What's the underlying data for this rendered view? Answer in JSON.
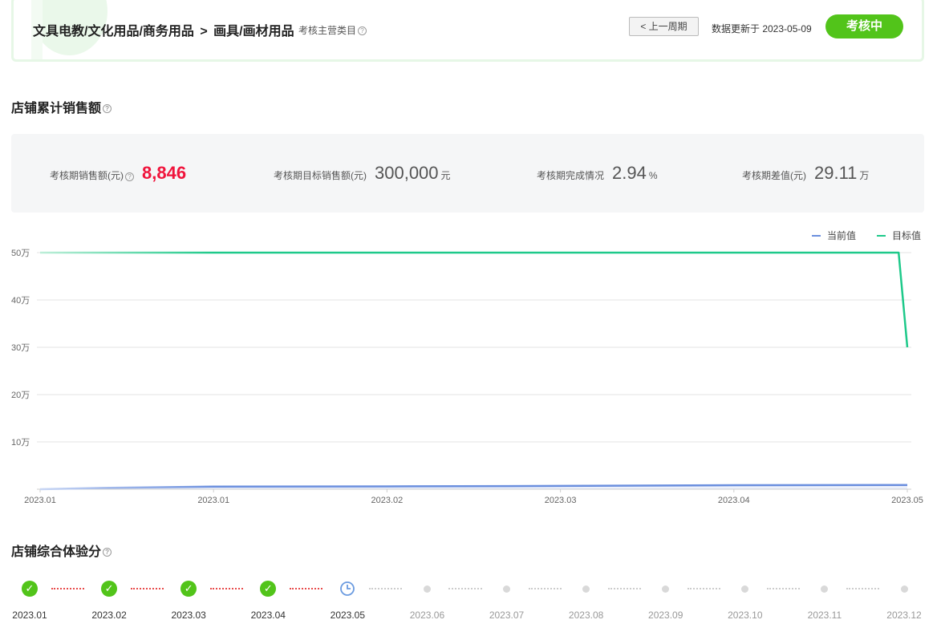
{
  "header": {
    "breadcrumb": [
      "文具电教/文化用品/商务用品",
      "画具/画材用品"
    ],
    "breadcrumb_separator": ">",
    "category_tip": "考核主营类目",
    "prev_button": "< 上一周期",
    "update_text": "数据更新于 2023-05-09",
    "status": "考核中"
  },
  "sales_section": {
    "title": "店铺累计销售额",
    "stats": [
      {
        "label": "考核期销售额(元)",
        "value": "8,846",
        "unit": "",
        "highlight": true,
        "help": true
      },
      {
        "label": "考核期目标销售额(元)",
        "value": "300,000",
        "unit": "元",
        "highlight": false,
        "help": false
      },
      {
        "label": "考核期完成情况",
        "value": "2.94",
        "unit": "%",
        "highlight": false,
        "help": false
      },
      {
        "label": "考核期差值(元)",
        "value": "29.11",
        "unit": "万",
        "highlight": false,
        "help": false
      }
    ]
  },
  "legend": [
    {
      "name": "当前值",
      "color": "#6b8fde"
    },
    {
      "name": "目标值",
      "color": "#1ec98a"
    }
  ],
  "chart_data": {
    "type": "line",
    "x_tick_labels": [
      "2023.01",
      "2023.01",
      "2023.02",
      "2023.03",
      "2023.04",
      "2023.05"
    ],
    "y_tick_labels": [
      "10万",
      "20万",
      "30万",
      "40万",
      "50万"
    ],
    "ylim": [
      0,
      50
    ],
    "y_unit": "万",
    "grid": true,
    "legend_position": "top-right",
    "series": [
      {
        "name": "当前值",
        "color": "#6b8fde",
        "points": [
          [
            0,
            0
          ],
          [
            0.4,
            0.3
          ],
          [
            1,
            0.55
          ],
          [
            2,
            0.6
          ],
          [
            3,
            0.7
          ],
          [
            4,
            0.85
          ],
          [
            4.9,
            0.88
          ],
          [
            5,
            0.88
          ]
        ]
      },
      {
        "name": "目标值",
        "color": "#1ec98a",
        "points": [
          [
            0,
            50
          ],
          [
            4.95,
            50
          ],
          [
            5,
            30
          ]
        ]
      }
    ]
  },
  "score_section": {
    "title": "店铺综合体验分",
    "months": [
      {
        "label": "2023.01",
        "state": "done"
      },
      {
        "label": "2023.02",
        "state": "done"
      },
      {
        "label": "2023.03",
        "state": "done"
      },
      {
        "label": "2023.04",
        "state": "done"
      },
      {
        "label": "2023.05",
        "state": "current"
      },
      {
        "label": "2023.06",
        "state": "future"
      },
      {
        "label": "2023.07",
        "state": "future"
      },
      {
        "label": "2023.08",
        "state": "future"
      },
      {
        "label": "2023.09",
        "state": "future"
      },
      {
        "label": "2023.10",
        "state": "future"
      },
      {
        "label": "2023.11",
        "state": "future"
      },
      {
        "label": "2023.12",
        "state": "future"
      }
    ]
  },
  "colors": {
    "accent_green": "#52c41a",
    "highlight_red": "#f0143c"
  }
}
